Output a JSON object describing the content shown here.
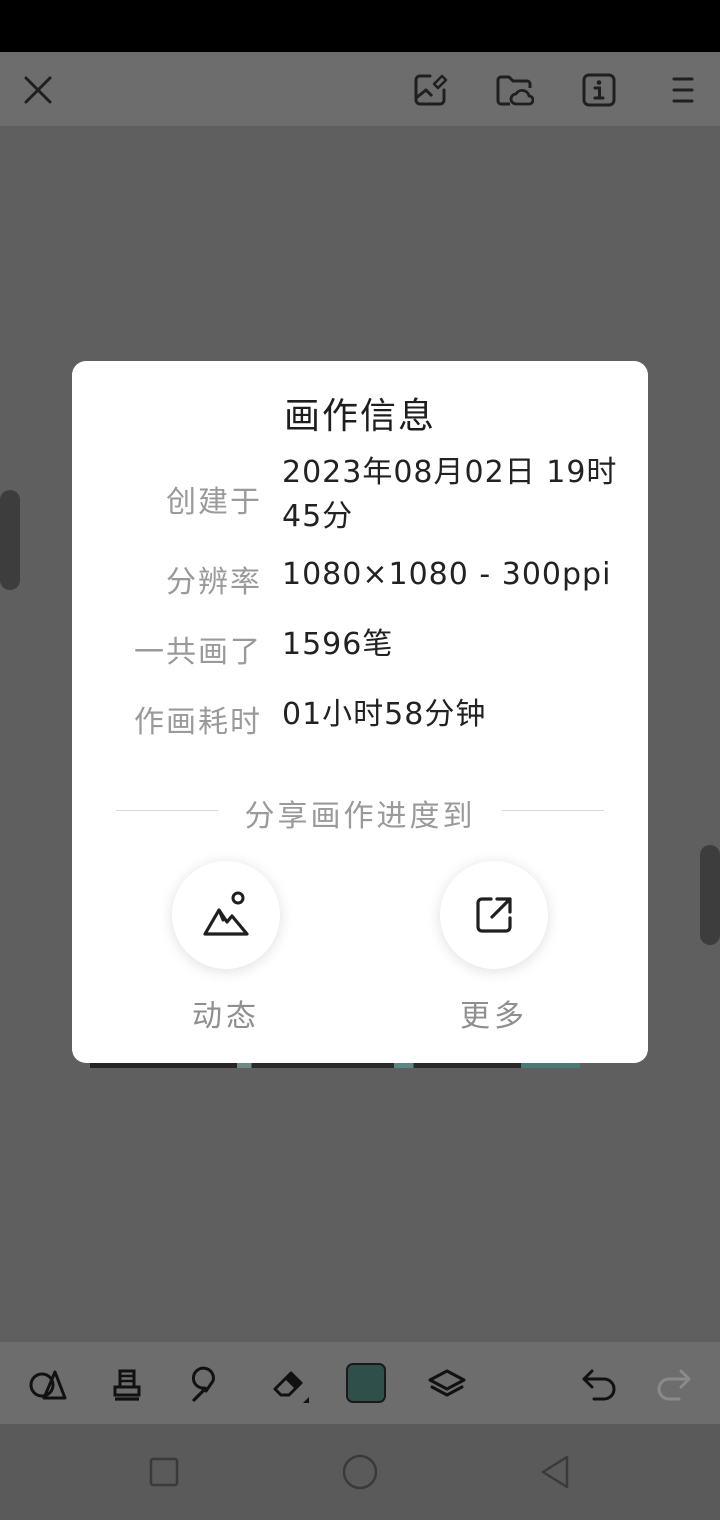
{
  "toolbar": {
    "icons": [
      "close-icon",
      "import-image-icon",
      "cloud-folder-icon",
      "info-icon",
      "menu-icon"
    ]
  },
  "dialog": {
    "title": "画作信息",
    "rows": [
      {
        "label": "创建于",
        "value": "2023年08月02日 19时45分"
      },
      {
        "label": "分辨率",
        "value": "1080×1080 - 300ppi"
      },
      {
        "label": "一共画了",
        "value": "1596笔"
      },
      {
        "label": "作画耗时",
        "value": "01小时58分钟"
      }
    ],
    "share_title": "分享画作进度到",
    "share_options": [
      {
        "label": "动态",
        "icon": "mountain-image-icon"
      },
      {
        "label": "更多",
        "icon": "external-share-icon"
      }
    ]
  },
  "tools": {
    "icons": [
      "shapes-icon",
      "stamp-icon",
      "smudge-icon",
      "eraser-icon",
      "color-swatch",
      "layers-icon",
      "undo-icon",
      "redo-icon"
    ],
    "current_color": "#2f4f4a"
  },
  "nav": {
    "icons": [
      "recent-apps-icon",
      "home-icon",
      "back-icon"
    ]
  }
}
